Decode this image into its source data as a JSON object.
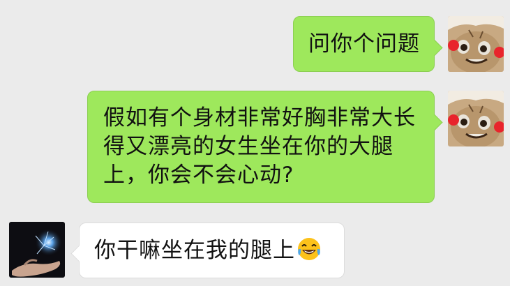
{
  "messages": [
    {
      "side": "right",
      "text": "问你个问题"
    },
    {
      "side": "right",
      "text": "假如有个身材非常好胸非常大长得又漂亮的女生坐在你的大腿上，你会不会心动?"
    },
    {
      "side": "left",
      "text": "你干嘛坐在我的腿上",
      "emoji": "laughing-tears-emoji"
    }
  ],
  "colors": {
    "background": "#ebebeb",
    "sent_bubble": "#9ee85c",
    "received_bubble": "#ffffff"
  },
  "icons": {
    "self_avatar": "cartoon-cat-avatar",
    "other_avatar": "glowing-hand-avatar"
  }
}
